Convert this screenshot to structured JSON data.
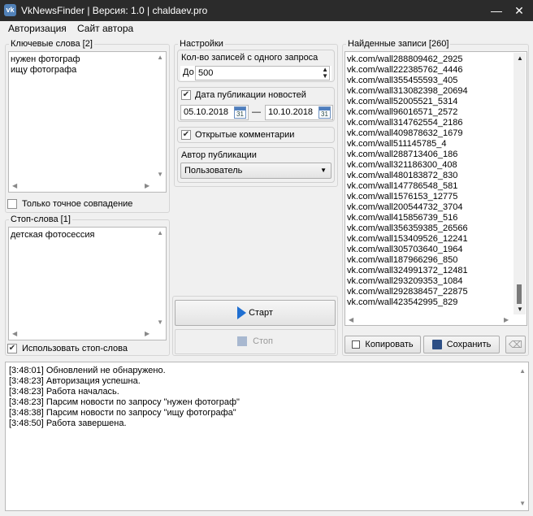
{
  "window": {
    "title": "VkNewsFinder | Версия: 1.0 | chaldaev.pro",
    "icon": "vk-logo-icon",
    "minimize": "—",
    "close": "✕"
  },
  "menu": {
    "auth": "Авторизация",
    "author_site": "Сайт автора"
  },
  "keywords": {
    "legend": "Ключевые слова [2]",
    "lines": [
      "нужен фотограф",
      "ищу фотографа"
    ],
    "exact_match_label": "Только точное совпадение",
    "exact_match_checked": false
  },
  "stopwords": {
    "legend": "Стоп-слова [1]",
    "lines": [
      "детская фотосессия"
    ],
    "use_label": "Использовать стоп-слова",
    "use_checked": true
  },
  "settings": {
    "legend": "Настройки",
    "count_label": "Кол-во записей с одного запроса",
    "count_prefix": "До",
    "count_value": "500",
    "date_label": "Дата публикации новостей",
    "date_checked": true,
    "date_from": "05.10.2018",
    "date_sep": "—",
    "date_to": "10.10.2018",
    "cal_day": "31",
    "comments_label": "Открытые комментарии",
    "comments_checked": true,
    "author_label": "Автор публикации",
    "author_value": "Пользователь"
  },
  "actions": {
    "start": "Старт",
    "stop": "Стоп"
  },
  "results": {
    "legend": "Найденные записи [260]",
    "items": [
      "vk.com/wall288809462_2925",
      "vk.com/wall222385762_4446",
      "vk.com/wall355455593_405",
      "vk.com/wall313082398_20694",
      "vk.com/wall52005521_5314",
      "vk.com/wall96016571_2572",
      "vk.com/wall314762554_2186",
      "vk.com/wall409878632_1679",
      "vk.com/wall511145785_4",
      "vk.com/wall288713406_186",
      "vk.com/wall321186300_408",
      "vk.com/wall480183872_830",
      "vk.com/wall147786548_581",
      "vk.com/wall1576153_12775",
      "vk.com/wall200544732_3704",
      "vk.com/wall415856739_516",
      "vk.com/wall356359385_26566",
      "vk.com/wall153409526_12241",
      "vk.com/wall305703640_1964",
      "vk.com/wall187966296_850",
      "vk.com/wall324991372_12481",
      "vk.com/wall293209353_1084",
      "vk.com/wall292838457_22875",
      "vk.com/wall423542995_829"
    ],
    "copy": "Копировать",
    "save": "Сохранить"
  },
  "log": {
    "lines": [
      "[3:48:01] Обновлений не обнаружено.",
      "[3:48:23] Авторизация успешна.",
      "[3:48:23] Работа началась.",
      "[3:48:23] Парсим новости по запросу \"нужен фотограф\"",
      "[3:48:38] Парсим новости по запросу \"ищу фотографа\"",
      "[3:48:50] Работа завершена."
    ]
  },
  "colors": {
    "titlebar": "#2b2b2b",
    "vk_blue": "#5181b8",
    "play_blue": "#1f6fd1"
  }
}
